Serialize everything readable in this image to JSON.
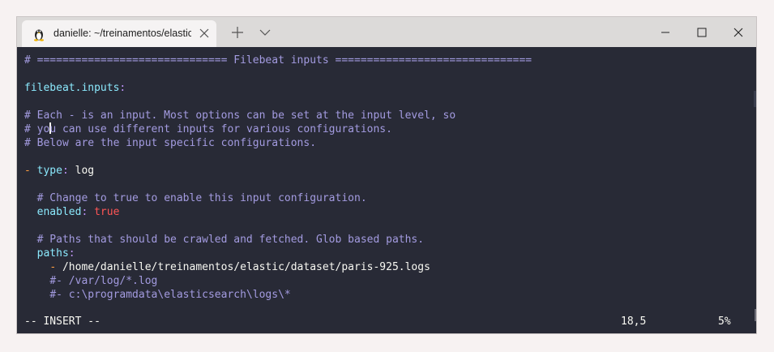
{
  "window": {
    "tab_title": "danielle: ~/treinamentos/elastic",
    "tab_icon": "linux-penguin-icon"
  },
  "editor": {
    "l1": "# ============================== Filebeat inputs ===============================",
    "l3_key": "filebeat.inputs",
    "l3_punc": ":",
    "l5": "# Each - is an input. Most options can be set at the input level, so",
    "l6_a": "# yo",
    "l6_b": "u can use different inputs for various configurations.",
    "l7": "# Below are the input specific configurations.",
    "l9_dash": "-",
    "l9_key": "type",
    "l9_punc": ":",
    "l9_val": "log",
    "l11": "# Change to true to enable this input configuration.",
    "l12_key": "enabled",
    "l12_punc": ":",
    "l12_val": "true",
    "l14": "# Paths that should be crawled and fetched. Glob based paths.",
    "l15_key": "paths",
    "l15_punc": ":",
    "l16_dash": "-",
    "l16_val": "/home/danielle/treinamentos/elastic/dataset/paris-925.logs",
    "l17": "#- /var/log/*.log",
    "l18": "#- c:\\programdata\\elasticsearch\\logs\\*"
  },
  "status": {
    "mode": "-- INSERT --",
    "position": "18,5",
    "percent": "5%"
  }
}
